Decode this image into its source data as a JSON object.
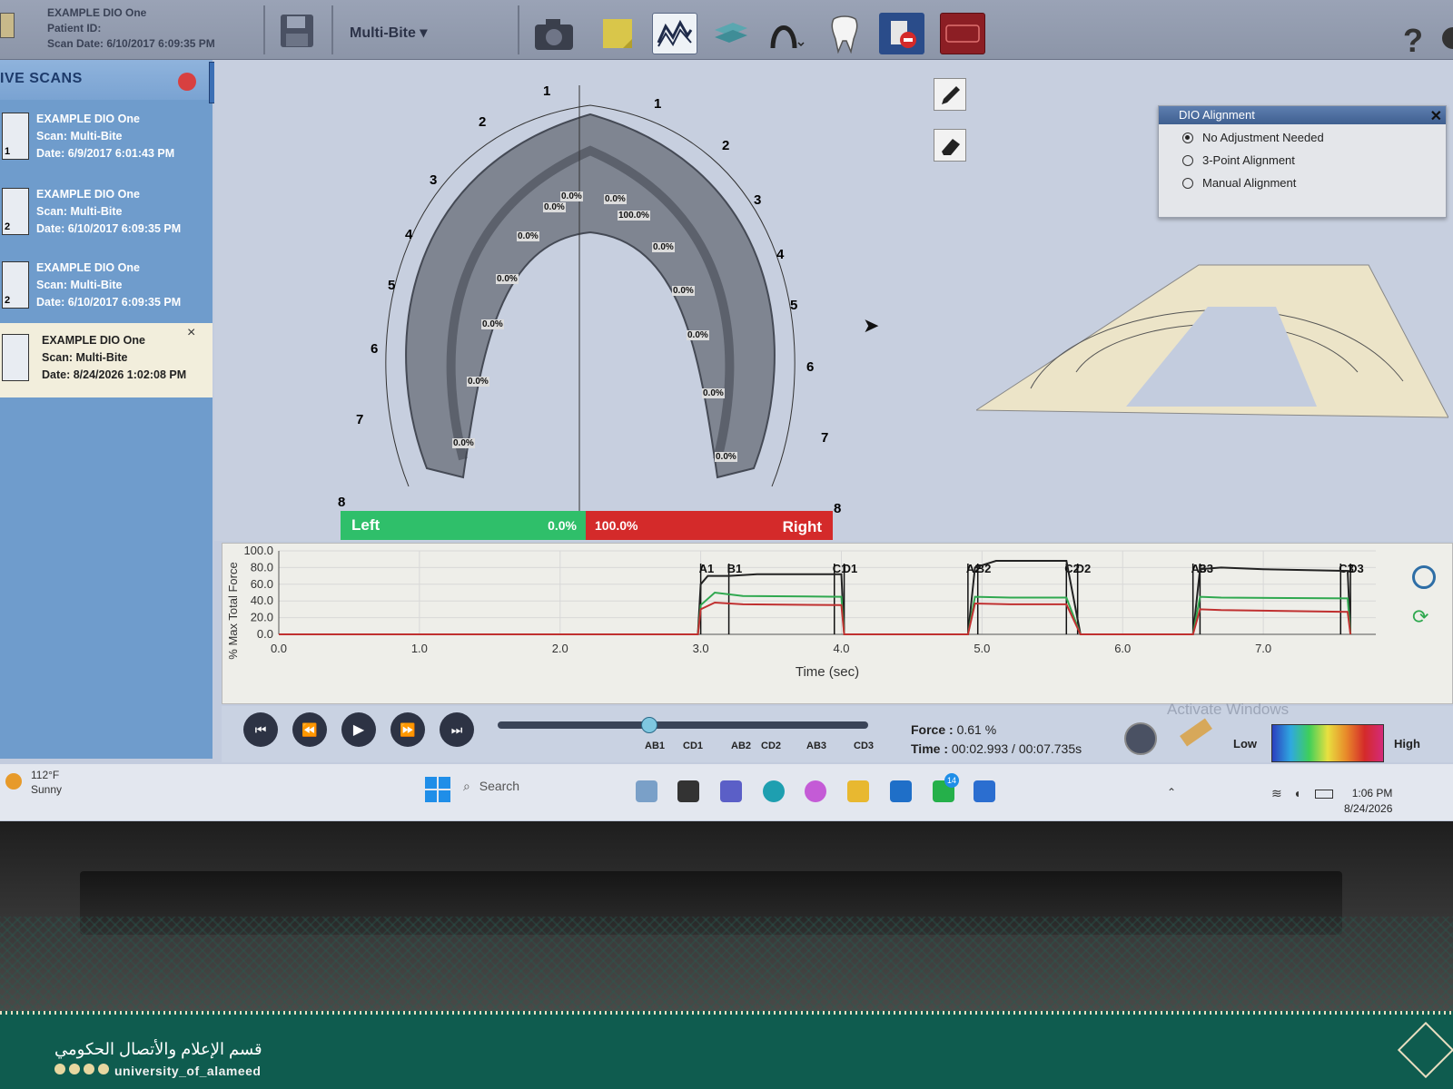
{
  "header": {
    "patient_name": "EXAMPLE DIO One",
    "patient_id_label": "Patient ID:",
    "scan_date_label": "Scan Date:",
    "scan_date": "6/10/2017 6:09:35 PM",
    "mode": "Multi-Bite",
    "help": "?"
  },
  "sidebar": {
    "title": "IVE SCANS",
    "scans": [
      {
        "name": "EXAMPLE DIO One",
        "scan": "Scan: Multi-Bite",
        "date": "Date: 6/9/2017 6:01:43 PM",
        "num": "1"
      },
      {
        "name": "EXAMPLE DIO One",
        "scan": "Scan: Multi-Bite",
        "date": "Date: 6/10/2017 6:09:35 PM",
        "num": "2"
      },
      {
        "name": "EXAMPLE DIO One",
        "scan": "Scan: Multi-Bite",
        "date": "Date: 6/10/2017 6:09:35 PM",
        "num": "2"
      },
      {
        "name": "EXAMPLE DIO One",
        "scan": "Scan: Multi-Bite",
        "date": "Date: 8/24/2026 1:02:08 PM",
        "num": ""
      }
    ],
    "close": "×"
  },
  "arch": {
    "left_teeth": [
      "1",
      "2",
      "3",
      "4",
      "5",
      "6",
      "7",
      "8"
    ],
    "right_teeth": [
      "1",
      "2",
      "3",
      "4",
      "5",
      "6",
      "7",
      "8"
    ],
    "left_pcts": [
      "0.0%",
      "0.0%",
      "0.0%",
      "0.0%",
      "0.0%",
      "0.0%",
      "0.0%"
    ],
    "right_pcts": [
      "0.0%",
      "100.0%",
      "0.0%",
      "0.0%",
      "0.0%",
      "0.0%",
      "0.0%"
    ],
    "left_extra": "0.0%",
    "right_extra": "0.0%"
  },
  "balance": {
    "left_label": "Left",
    "left_value": "0.0%",
    "right_value": "100.0%",
    "right_label": "Right",
    "left_fraction": 0.0,
    "right_fraction": 1.0
  },
  "dio_alignment": {
    "title": "DIO Alignment",
    "close": "✕",
    "options": [
      "No Adjustment Needed",
      "3-Point Alignment",
      "Manual Alignment"
    ],
    "selected": 0
  },
  "chart_data": {
    "type": "line",
    "xlabel": "Time (sec)",
    "ylabel": "% Max Total Force",
    "xlim": [
      0,
      7.8
    ],
    "ylim": [
      0,
      100
    ],
    "x_ticks": [
      "0.0",
      "1.0",
      "2.0",
      "3.0",
      "4.0",
      "5.0",
      "6.0",
      "7.0"
    ],
    "y_ticks": [
      "0.0",
      "20.0",
      "40.0",
      "60.0",
      "80.0",
      "100.0"
    ],
    "grid": true,
    "markers": [
      {
        "label": "A1",
        "x": 3.0
      },
      {
        "label": "B1",
        "x": 3.2
      },
      {
        "label": "C1",
        "x": 3.95
      },
      {
        "label": "D1",
        "x": 4.02
      },
      {
        "label": "A2",
        "x": 4.9
      },
      {
        "label": "B2",
        "x": 4.97
      },
      {
        "label": "C2",
        "x": 5.6
      },
      {
        "label": "D2",
        "x": 5.68
      },
      {
        "label": "A3",
        "x": 6.5
      },
      {
        "label": "B3",
        "x": 6.55
      },
      {
        "label": "C3",
        "x": 7.55
      },
      {
        "label": "D3",
        "x": 7.62
      }
    ],
    "series": [
      {
        "color": "#222222",
        "x": [
          0,
          2.98,
          3.0,
          3.05,
          3.2,
          3.4,
          4.0,
          4.02,
          4.9,
          4.95,
          5.1,
          5.3,
          5.6,
          5.7,
          6.5,
          6.55,
          6.7,
          7.0,
          7.6,
          7.62
        ],
        "y": [
          0,
          0,
          60,
          70,
          70,
          72,
          72,
          0,
          0,
          80,
          88,
          88,
          88,
          0,
          0,
          78,
          80,
          78,
          76,
          0
        ]
      },
      {
        "color": "#2fa84f",
        "x": [
          0,
          2.98,
          3.0,
          3.1,
          3.3,
          4.0,
          4.02,
          4.9,
          4.95,
          5.2,
          5.6,
          5.7,
          6.5,
          6.55,
          6.7,
          7.6,
          7.62
        ],
        "y": [
          0,
          0,
          35,
          50,
          46,
          45,
          0,
          0,
          45,
          44,
          44,
          0,
          0,
          45,
          44,
          43,
          0
        ]
      },
      {
        "color": "#c03030",
        "x": [
          0,
          2.98,
          3.0,
          3.1,
          3.3,
          4.0,
          4.02,
          4.9,
          4.95,
          5.2,
          5.6,
          5.7,
          6.5,
          6.55,
          6.7,
          7.6,
          7.62
        ],
        "y": [
          0,
          0,
          30,
          38,
          36,
          35,
          0,
          0,
          37,
          36,
          36,
          0,
          0,
          30,
          29,
          27,
          0
        ]
      }
    ]
  },
  "playback": {
    "force_label": "Force :",
    "force_value": "0.61 %",
    "time_label": "Time :",
    "time_value": "00:02.993 / 00:07.735s",
    "progress_fraction": 0.41,
    "marker_labels": [
      "AB1",
      "CD1",
      "AB2",
      "CD2",
      "AB3",
      "CD3"
    ],
    "scale_low": "Low",
    "scale_high": "High",
    "watermark": "Activate Windows"
  },
  "taskbar": {
    "weather_temp": "112°F",
    "weather_text": "Sunny",
    "search_placeholder": "Search",
    "badge": "14",
    "time": "1:06 PM",
    "date": "8/24/2026"
  },
  "banner": {
    "org_name": "قسم الإعلام والأتصال الحكومي",
    "handle": "university_of_alameed"
  },
  "colors": {
    "left_green": "#2fbf6a",
    "right_red": "#d42a2a",
    "sidebar_blue": "#6f9ccc",
    "banner_green": "#0f5c4f"
  }
}
